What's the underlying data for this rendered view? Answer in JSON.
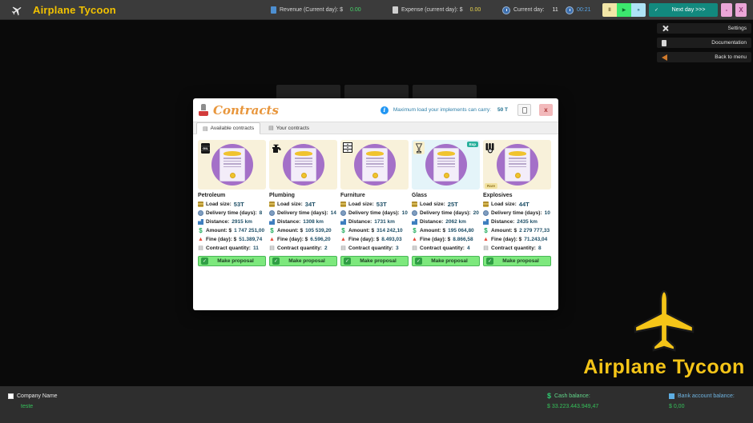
{
  "topbar": {
    "title": "Airplane Tycoon",
    "revenue_label": "Revenue (Current day): $",
    "revenue_value": "0.00",
    "expense_label": "Expense (current day): $",
    "expense_value": "0.00",
    "day_label": "Current day:",
    "day_value": "11",
    "time": "00:21",
    "pause_glyph": "II",
    "play_glyph": "▶",
    "fast_glyph": "»",
    "next_day_label": "Next day >>>",
    "minimize_glyph": "-",
    "close_glyph": "X"
  },
  "sidebar": {
    "items": [
      {
        "label": "Settings"
      },
      {
        "label": "Documentation"
      },
      {
        "label": "Back to menu"
      }
    ]
  },
  "modal": {
    "title": "Contracts",
    "info_icon_glyph": "i",
    "info_text": "Maximum load your implements can carry:",
    "info_value": "50 T",
    "close_glyph": "x",
    "tabs": [
      "Available contracts",
      "Your contracts"
    ],
    "labels": {
      "load": "Load size:",
      "delivery": "Delivery time (days):",
      "distance": "Distance:",
      "amount": "Amount: $",
      "fine": "Fine (day): $",
      "quantity": "Contract quantity:",
      "button": "Make proposal"
    },
    "cards": [
      {
        "name": "Petroleum",
        "icon": "oil",
        "icon_text": "OIL",
        "figure_bg": "#f8f1da",
        "load": "53T",
        "delivery": "8",
        "distance": "2915 km",
        "amount": "1 747 251,00",
        "fine": "51.389,74",
        "quantity": "11"
      },
      {
        "name": "Plumbing",
        "icon": "faucet",
        "figure_bg": "#f8f1da",
        "load": "34T",
        "delivery": "14",
        "distance": "1308 km",
        "amount": "105 539,20",
        "fine": "6.596,20",
        "quantity": "2"
      },
      {
        "name": "Furniture",
        "icon": "furniture",
        "figure_bg": "#f8f1da",
        "load": "53T",
        "delivery": "10",
        "distance": "1731 km",
        "amount": "314 242,10",
        "fine": "8.493,03",
        "quantity": "3"
      },
      {
        "name": "Glass",
        "icon": "glass",
        "figure_bg": "#e4f4f9",
        "load": "25T",
        "delivery": "20",
        "distance": "2062 km",
        "amount": "195 064,80",
        "fine": "8.866,58",
        "quantity": "4",
        "badge": {
          "label": "Exp",
          "bg": "#29b09d",
          "fg": "#ffffff",
          "pos": "tr"
        }
      },
      {
        "name": "Explosives",
        "icon": "dynamite",
        "figure_bg": "#f8f1da",
        "load": "44T",
        "delivery": "10",
        "distance": "2435 km",
        "amount": "2 279 777,33",
        "fine": "71.243,04",
        "quantity": "8",
        "badge": {
          "label": "Rare",
          "bg": "#f2e2a0",
          "fg": "#8f7320",
          "pos": "bl"
        }
      }
    ]
  },
  "glyphs": {
    "dollar": "$",
    "warning": "▲",
    "doc": "▤",
    "check": "✓"
  },
  "watermark": {
    "title": "Airplane Tycoon"
  },
  "bottombar": {
    "company_label": "Company Name",
    "company_value": "teste",
    "cash_label": "Cash balance:",
    "cash_dollar": "$",
    "cash_value": "$ 33.223.443.949,47",
    "bank_label": "Bank account balance:",
    "bank_value": "$ 0,00"
  },
  "colors": {
    "accent_yellow": "#f2c200",
    "teal_button": "#12897e",
    "green_value": "#35c05a",
    "purple_circle": "#a470c8",
    "proposal_green": "#7de87d"
  }
}
